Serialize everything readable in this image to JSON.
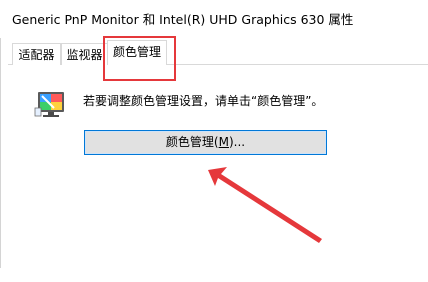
{
  "window": {
    "title": "Generic PnP Monitor 和 Intel(R) UHD Graphics 630 属性"
  },
  "tabs": [
    {
      "label": "适配器"
    },
    {
      "label": "监视器"
    },
    {
      "label": "颜色管理",
      "selected": true
    }
  ],
  "color_management": {
    "description": "若要调整颜色管理设置，请单击“颜色管理”。",
    "button_prefix": "颜色管理(",
    "button_mnemonic": "M",
    "button_suffix": ")..."
  },
  "annotation": {
    "box_color": "#e5383b",
    "arrow_color": "#e5383b"
  },
  "icons": [
    "color-monitor-icon",
    "annotation-arrow"
  ]
}
